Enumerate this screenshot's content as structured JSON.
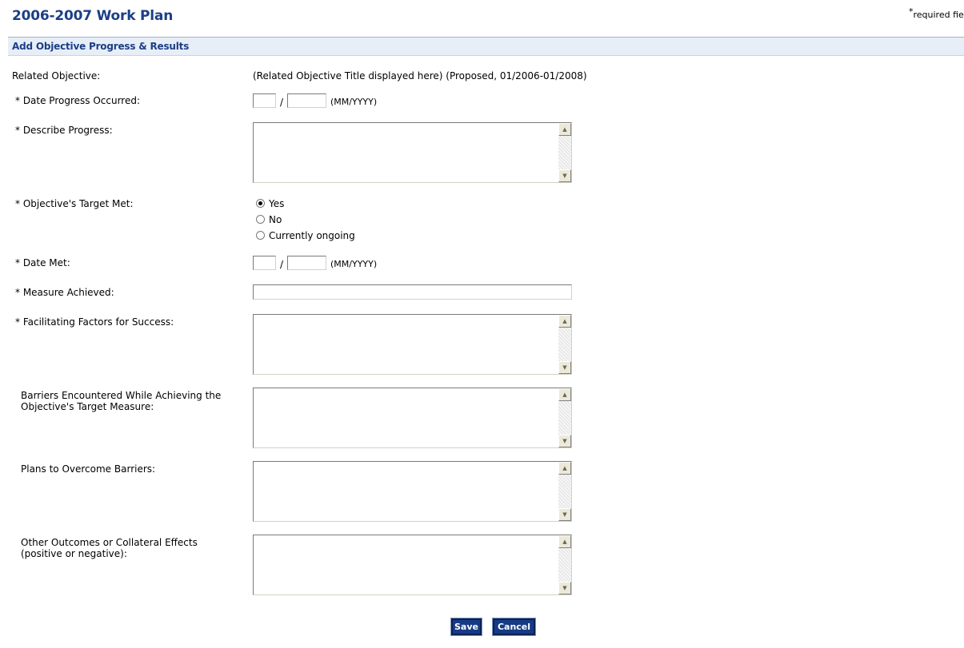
{
  "page": {
    "title": "2006-2007 Work Plan",
    "required_star": "*",
    "required_note": "required fie"
  },
  "section": {
    "title": "Add Objective Progress & Results"
  },
  "form": {
    "related_objective": {
      "label": "Related Objective:",
      "value": "(Related Objective Title displayed here) (Proposed, 01/2006-01/2008)"
    },
    "date_progress": {
      "label": "* Date Progress Occurred:",
      "separator": "/",
      "hint": "(MM/YYYY)",
      "month": "",
      "year": ""
    },
    "describe_progress": {
      "label": "* Describe Progress:",
      "value": ""
    },
    "target_met": {
      "label": "* Objective's Target Met:",
      "options": [
        "Yes",
        "No",
        "Currently ongoing"
      ],
      "selected": "Yes"
    },
    "date_met": {
      "label": "* Date Met:",
      "separator": "/",
      "hint": "(MM/YYYY)",
      "month": "",
      "year": ""
    },
    "measure_achieved": {
      "label": "* Measure Achieved:",
      "value": ""
    },
    "facilitating_factors": {
      "label": "* Facilitating Factors for Success:",
      "value": ""
    },
    "barriers": {
      "label_line1": "Barriers Encountered While Achieving the",
      "label_line2": "Objective's Target Measure:",
      "value": ""
    },
    "plans": {
      "label": "Plans to Overcome Barriers:",
      "value": ""
    },
    "other_outcomes": {
      "label_line1": "Other Outcomes or Collateral Effects",
      "label_line2": "(positive or negative):",
      "value": ""
    }
  },
  "buttons": {
    "save": "Save",
    "cancel": "Cancel"
  },
  "icons": {
    "scroll_up": "scroll-up-arrow-icon",
    "scroll_down": "scroll-down-arrow-icon"
  },
  "colors": {
    "title": "#1b3f86",
    "section_bg": "#e8eef8",
    "button_bg": "#173a86"
  }
}
